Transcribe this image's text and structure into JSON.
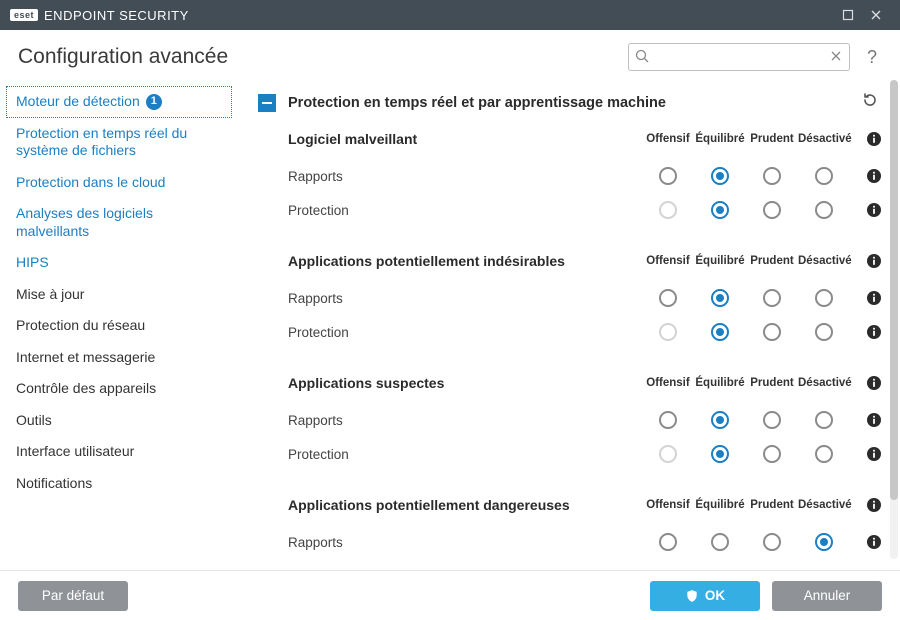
{
  "titlebar": {
    "brand_logo": "eset",
    "brand_text": "ENDPOINT SECURITY"
  },
  "header": {
    "title": "Configuration avancée",
    "search_value": ""
  },
  "sidebar": {
    "items": [
      {
        "label": "Moteur de détection",
        "badge": "1"
      },
      {
        "label": "Protection en temps réel du système de fichiers"
      },
      {
        "label": "Protection dans le cloud"
      },
      {
        "label": "Analyses des logiciels malveillants"
      },
      {
        "label": "HIPS"
      },
      {
        "label": "Mise à jour"
      },
      {
        "label": "Protection du réseau"
      },
      {
        "label": "Internet et messagerie"
      },
      {
        "label": "Contrôle des appareils"
      },
      {
        "label": "Outils"
      },
      {
        "label": "Interface utilisateur"
      },
      {
        "label": "Notifications"
      }
    ]
  },
  "section": {
    "title": "Protection en temps réel et par apprentissage machine",
    "columns": [
      "Offensif",
      "Équilibré",
      "Prudent",
      "Désactivé"
    ],
    "row_labels": {
      "rapports": "Rapports",
      "protection": "Protection"
    },
    "groups": [
      {
        "title": "Logiciel malveillant",
        "rows": [
          {
            "kind": "rapports",
            "selected": 1,
            "disabled": []
          },
          {
            "kind": "protection",
            "selected": 1,
            "disabled": [
              0
            ]
          }
        ]
      },
      {
        "title": "Applications potentiellement indésirables",
        "rows": [
          {
            "kind": "rapports",
            "selected": 1,
            "disabled": []
          },
          {
            "kind": "protection",
            "selected": 1,
            "disabled": [
              0
            ]
          }
        ]
      },
      {
        "title": "Applications suspectes",
        "rows": [
          {
            "kind": "rapports",
            "selected": 1,
            "disabled": []
          },
          {
            "kind": "protection",
            "selected": 1,
            "disabled": [
              0
            ]
          }
        ]
      },
      {
        "title": "Applications potentiellement dangereuses",
        "rows": [
          {
            "kind": "rapports",
            "selected": 3,
            "disabled": []
          }
        ]
      }
    ]
  },
  "footer": {
    "default": "Par défaut",
    "ok": "OK",
    "cancel": "Annuler"
  }
}
